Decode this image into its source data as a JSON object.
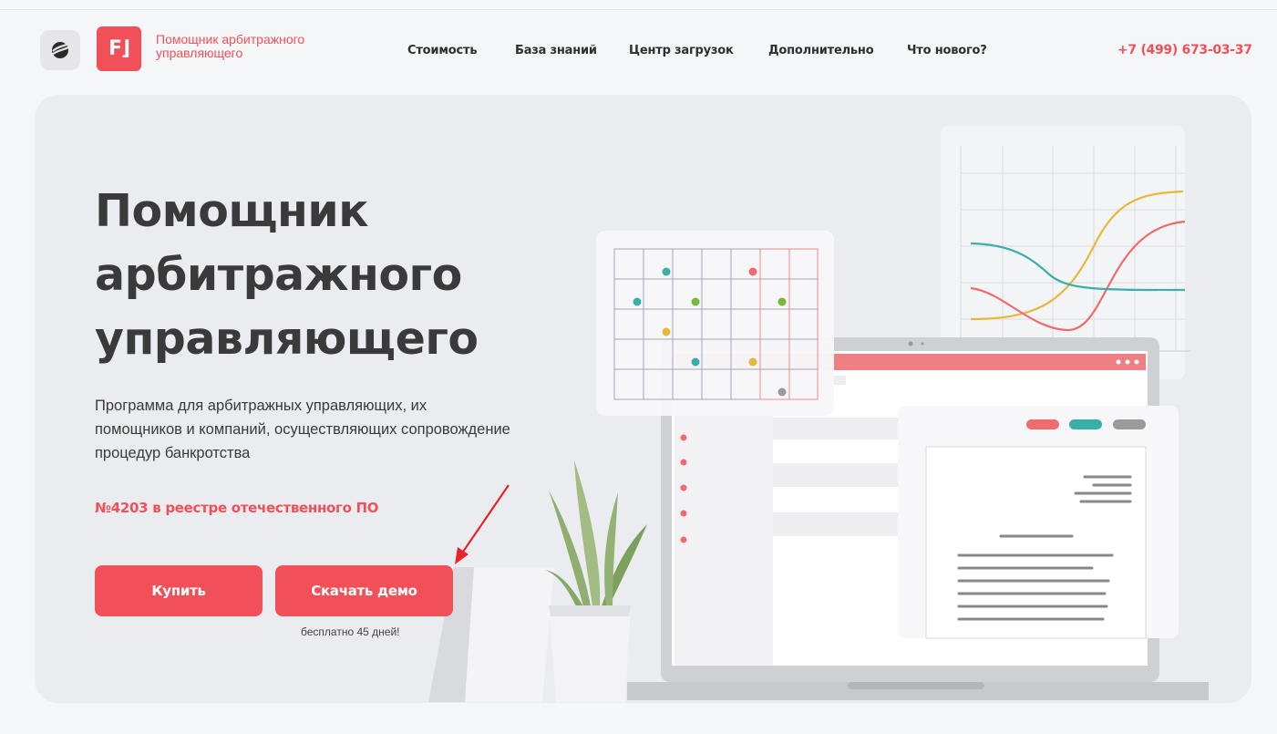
{
  "header": {
    "brand_text": "Помощник арбитражного управляющего",
    "product_logo_text": "F⌋",
    "nav": [
      {
        "label": "Стоимость"
      },
      {
        "label": "База знаний"
      },
      {
        "label": "Центр загрузок"
      },
      {
        "label": "Дополнительно"
      },
      {
        "label": "Что нового?"
      }
    ],
    "phone": "+7 (499) 673-03-37"
  },
  "hero": {
    "title": "Помощник арбитражного управляющего",
    "description": "Программа для арбитражных управляющих, их помощников и компаний, осуществляющих сопровождение процедур банкротства",
    "registry": "№4203 в реестре отечественного ПО",
    "buy_label": "Купить",
    "demo_label": "Скачать демо",
    "free_note": "бесплатно 45 дней!"
  },
  "colors": {
    "brand": "#f25058",
    "teal": "#3aaea8",
    "yellow": "#e5b93b",
    "green": "#76b83a",
    "gray": "#9a9a9a",
    "hero_bg": "#ebecef"
  },
  "icons": {
    "main_logo": "company-logo-icon",
    "arrow": "red-arrow-pointer-icon"
  }
}
